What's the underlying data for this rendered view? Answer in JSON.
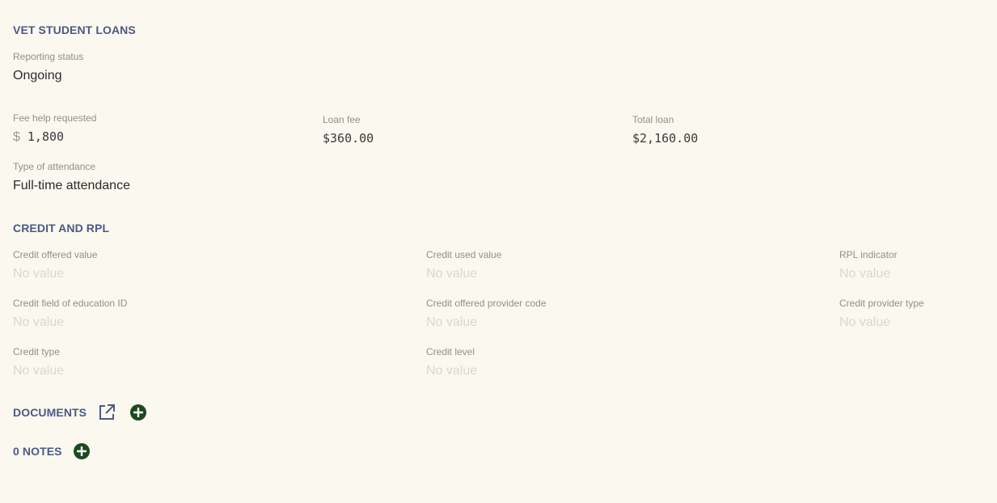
{
  "vet": {
    "title": "VET STUDENT LOANS",
    "reporting_status": {
      "label": "Reporting status",
      "value": "Ongoing"
    },
    "fee_help": {
      "label": "Fee help requested",
      "currency": "$",
      "value": "1,800"
    },
    "loan_fee": {
      "label": "Loan fee",
      "value": "$360.00"
    },
    "total_loan": {
      "label": "Total loan",
      "value": "$2,160.00"
    },
    "attendance": {
      "label": "Type of attendance",
      "value": "Full-time attendance"
    }
  },
  "credit": {
    "title": "CREDIT AND RPL",
    "credit_offered_value": {
      "label": "Credit offered value",
      "value": "No value"
    },
    "credit_used_value": {
      "label": "Credit used value",
      "value": "No value"
    },
    "rpl_indicator": {
      "label": "RPL indicator",
      "value": "No value"
    },
    "credit_field_education": {
      "label": "Credit field of education ID",
      "value": "No value"
    },
    "credit_offered_provider_code": {
      "label": "Credit offered provider code",
      "value": "No value"
    },
    "credit_provider_type": {
      "label": "Credit provider type",
      "value": "No value"
    },
    "credit_type": {
      "label": "Credit type",
      "value": "No value"
    },
    "credit_level": {
      "label": "Credit level",
      "value": "No value"
    }
  },
  "documents": {
    "title": "DOCUMENTS",
    "open_icon": "external-link-icon",
    "add_icon": "plus-circle-icon"
  },
  "notes": {
    "title": "0 NOTES",
    "add_icon": "plus-circle-icon"
  },
  "colors": {
    "background": "#fbf8f0",
    "section_title": "#4a5a85",
    "add_button": "#1c4a1f",
    "empty_value": "#d9d7d0"
  }
}
